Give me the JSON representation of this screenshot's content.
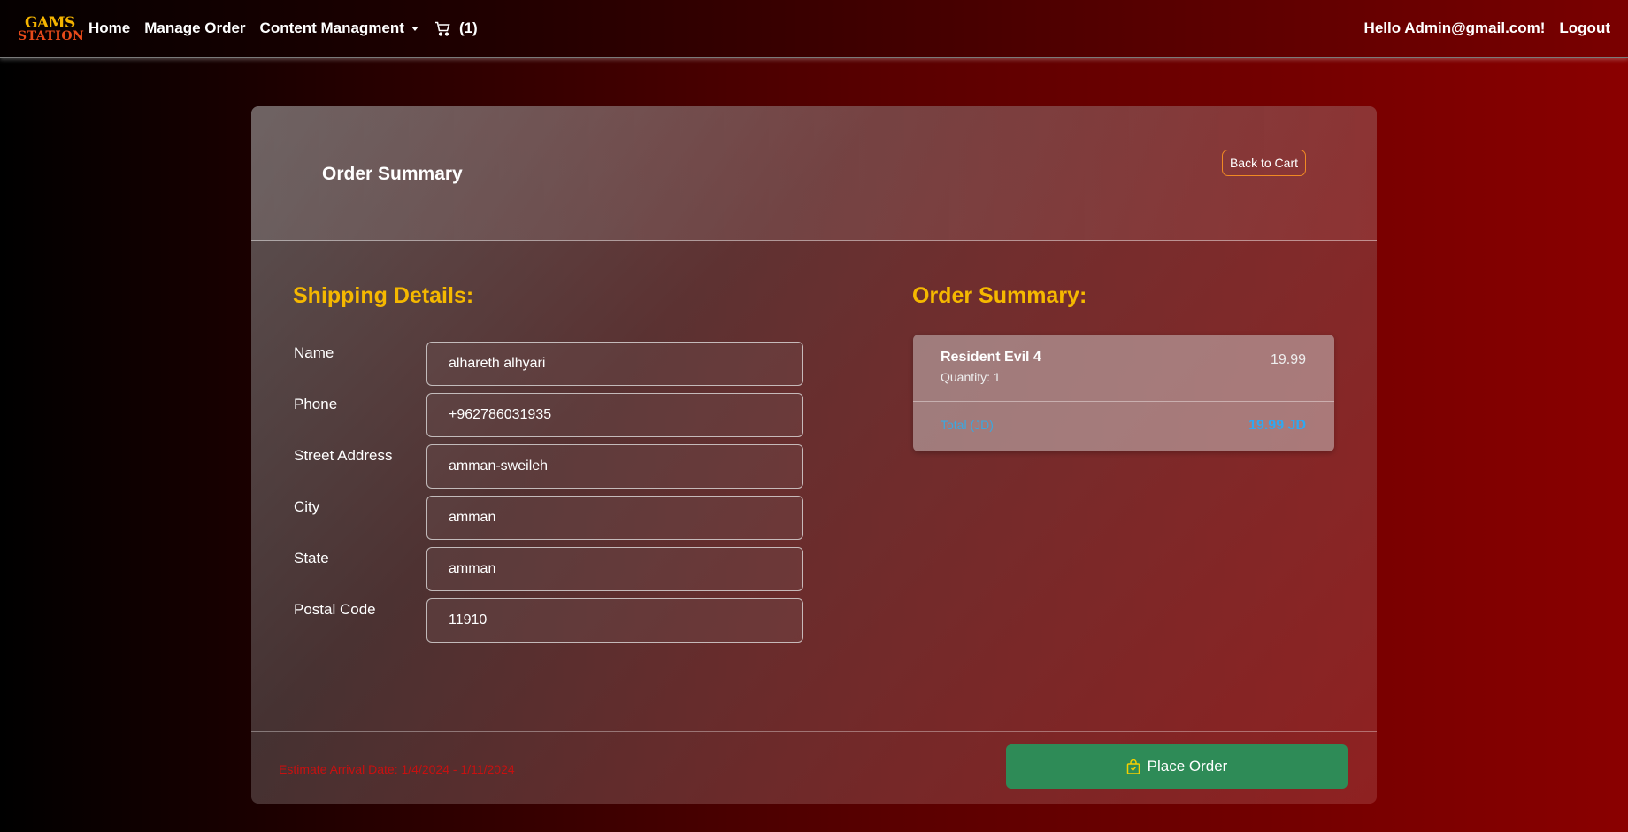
{
  "navbar": {
    "logo_line1": "GAMS",
    "logo_line2": "STATION",
    "links": [
      "Home",
      "Manage Order",
      "Content Managment"
    ],
    "cart_count": "(1)",
    "greeting": "Hello Admin@gmail.com!",
    "logout": "Logout"
  },
  "card": {
    "title": "Order Summary",
    "back_label": "Back to Cart"
  },
  "shipping": {
    "title": "Shipping Details:",
    "fields": [
      {
        "label": "Name",
        "value": "alhareth alhyari"
      },
      {
        "label": "Phone",
        "value": "+962786031935"
      },
      {
        "label": "Street Address",
        "value": "amman-sweileh"
      },
      {
        "label": "City",
        "value": "amman"
      },
      {
        "label": "State",
        "value": "amman"
      },
      {
        "label": "Postal Code",
        "value": "11910"
      }
    ]
  },
  "summary": {
    "title": "Order Summary:",
    "item": {
      "name": "Resident Evil 4",
      "quantity": "Quantity: 1",
      "price": "19.99"
    },
    "total_label": "Total (JD)",
    "total_value": "19.99 JD"
  },
  "footer": {
    "arrival": "Estimate Arrival Date: 1/4/2024 - 1/11/2024",
    "place_order": "Place Order"
  },
  "colors": {
    "accent_yellow": "#f5b800",
    "button_green": "#2e8b57",
    "back_border": "#f08a24",
    "total_blue": "#2fa8f0",
    "arrival_red": "#c81010"
  },
  "icons": {
    "cart": "cart-icon",
    "place_order": "shopping-bag-icon"
  }
}
